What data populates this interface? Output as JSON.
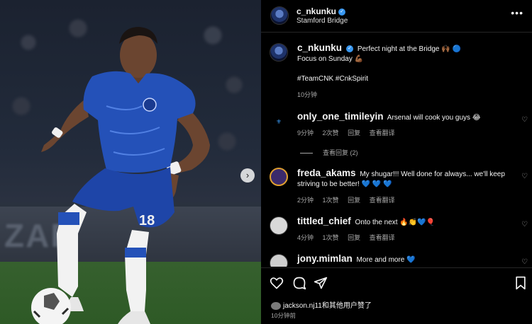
{
  "post": {
    "username": "c_nkunku",
    "location": "Stamford Bridge",
    "caption_line1": "Perfect night at the Bridge 🙌🏾 🔵",
    "caption_line2": "Focus on Sunday 💪🏾",
    "hashtags": "#TeamCNK #CnkSpirit",
    "caption_time": "10分钟",
    "photo_adboard_text": "ZAP",
    "jersey_number": "18"
  },
  "comments": [
    {
      "user": "only_one_timileyin",
      "text": "Arsenal will cook you guys 😂",
      "time": "9分钟",
      "likes": "2次赞",
      "reply": "回复",
      "translate": "查看翻译",
      "view_replies": "查看回复 (2)"
    },
    {
      "user": "freda_akams",
      "text": "My shugar!!! Well done for always... we'll keep striving to be better! 💙 💙 💙",
      "time": "2分钟",
      "likes": "1次赞",
      "reply": "回复",
      "translate": "查看翻译"
    },
    {
      "user": "tittled_chief",
      "text": "Onto the next 🔥👏💙🎈",
      "time": "4分钟",
      "likes": "1次赞",
      "reply": "回复",
      "translate": "查看翻译"
    },
    {
      "user": "jony.mimlan",
      "text": "More and more 💙"
    }
  ],
  "footer": {
    "liked_by": "jackson.nj11和其他用户赞了",
    "time_ago": "10分钟前"
  },
  "icons": {
    "like": "heart-icon",
    "comment": "comment-icon",
    "share": "send-icon",
    "save": "bookmark-icon",
    "more": "more-options-icon",
    "verified": "verified-badge-icon"
  },
  "colors": {
    "background": "#000000",
    "text": "#f5f5f5",
    "muted": "#a8a8a8",
    "verified": "#3897f0",
    "jersey": "#2451b8"
  }
}
